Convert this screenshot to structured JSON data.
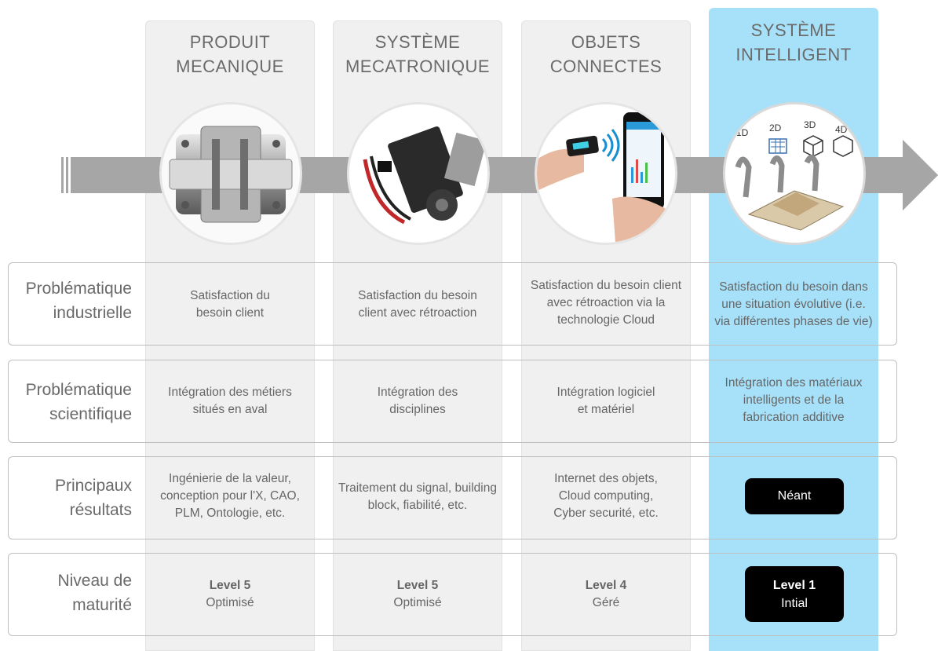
{
  "columns": [
    {
      "title": [
        "PRODUIT",
        "MECANIQUE"
      ],
      "image": "mechanical-coupling-image",
      "highlight": false
    },
    {
      "title": [
        "SYSTÈME",
        "MECATRONIQUE"
      ],
      "image": "servo-motor-image",
      "highlight": false
    },
    {
      "title": [
        "OBJETS",
        "CONNECTES"
      ],
      "image": "connected-phone-image",
      "highlight": false
    },
    {
      "title": [
        "SYSTÈME",
        "INTELLIGENT"
      ],
      "image": "smart-system-image",
      "highlight": true,
      "image_labels": [
        "1D",
        "2D",
        "3D",
        "4D"
      ]
    }
  ],
  "rows": [
    {
      "label": [
        "Problématique",
        "industrielle"
      ],
      "cells": [
        [
          "Satisfaction du",
          "besoin client"
        ],
        [
          "Satisfaction du besoin",
          "client avec rétroaction"
        ],
        [
          "Satisfaction du besoin client",
          "avec rétroaction via la",
          "technologie Cloud"
        ],
        [
          "Satisfaction du besoin dans",
          "une situation évolutive (i.e.",
          "via différentes phases de vie)"
        ]
      ]
    },
    {
      "label": [
        "Problématique",
        "scientifique"
      ],
      "cells": [
        [
          "Intégration des métiers",
          "situés en aval"
        ],
        [
          "Intégration des",
          "disciplines"
        ],
        [
          "Intégration logiciel",
          "et matériel"
        ],
        [
          "Intégration des matériaux",
          "intelligents et de la",
          "fabrication additive"
        ]
      ]
    },
    {
      "label": [
        "Principaux",
        "résultats"
      ],
      "cells": [
        [
          "Ingénierie de la valeur,",
          "conception pour l'X, CAO,",
          "PLM, Ontologie, etc."
        ],
        [
          "Traitement du signal, building",
          "block, fiabilité, etc."
        ],
        [
          "Internet des objets,",
          "Cloud computing,",
          "Cyber securité, etc."
        ],
        [
          "Néant"
        ]
      ]
    },
    {
      "label": [
        "Niveau de",
        "maturité"
      ],
      "cells": [
        [
          "Level 5",
          "Optimisé"
        ],
        [
          "Level 5",
          "Optimisé"
        ],
        [
          "Level 4",
          "Géré"
        ],
        [
          "Level 1",
          "Intial"
        ]
      ]
    }
  ],
  "colors": {
    "highlight": "#a7e1f9",
    "column": "#f0f0f0",
    "arrow": "#a6a6a6",
    "badge": "#000000"
  }
}
